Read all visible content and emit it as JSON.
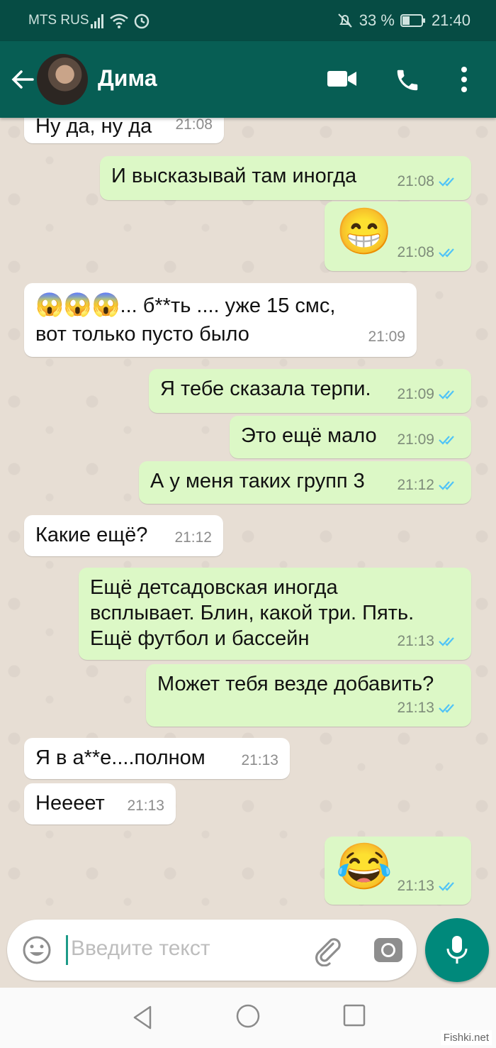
{
  "status_bar": {
    "carrier": "MTS RUS",
    "battery": "33 %",
    "time": "21:40"
  },
  "header": {
    "contact_name": "Дима"
  },
  "messages": [
    {
      "dir": "in",
      "text": "Ну да, ну да",
      "time": "21:08"
    },
    {
      "dir": "out",
      "text": "И высказывай там иногда",
      "time": "21:08"
    },
    {
      "dir": "out",
      "emoji": "😁",
      "time": "21:08"
    },
    {
      "dir": "in",
      "line1_emoji": "😱😱😱",
      "line1_text": "... б**ть .... уже 15 смс,",
      "line2_text": "вот только пусто было",
      "time": "21:09"
    },
    {
      "dir": "out",
      "text": "Я тебе сказала терпи.",
      "time": "21:09"
    },
    {
      "dir": "out",
      "text": "Это ещё мало",
      "time": "21:09"
    },
    {
      "dir": "out",
      "text": "А у меня таких групп 3",
      "time": "21:12"
    },
    {
      "dir": "in",
      "text": "Какие ещё?",
      "time": "21:12"
    },
    {
      "dir": "out",
      "line1": "Ещё детсадовская иногда",
      "line2": "всплывает. Блин, какой три. Пять.",
      "line3": "Ещё футбол и бассейн",
      "time": "21:13"
    },
    {
      "dir": "out",
      "text": "Может тебя везде добавить?",
      "time": "21:13"
    },
    {
      "dir": "in",
      "text": "Я в а**е....полном",
      "time": "21:13"
    },
    {
      "dir": "in",
      "text": "Неееет",
      "time": "21:13"
    },
    {
      "dir": "out",
      "emoji": "😂",
      "time": "21:13"
    }
  ],
  "composer": {
    "placeholder": "Введите текст"
  },
  "watermark": "Fishki.net",
  "colors": {
    "header": "#075e54",
    "outgoing_bubble": "#dcf8c6",
    "incoming_bubble": "#ffffff",
    "read_ticks": "#4fc3f7",
    "mic_button": "#00897b"
  }
}
